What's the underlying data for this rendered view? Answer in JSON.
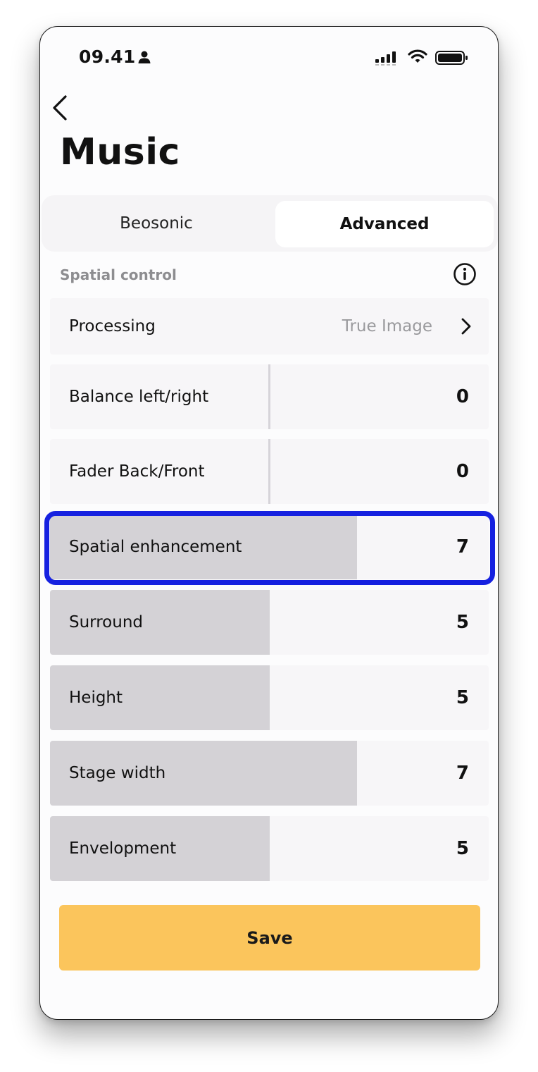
{
  "status_bar": {
    "time": "09.41"
  },
  "header": {
    "title": "Music"
  },
  "tabs": [
    {
      "label": "Beosonic",
      "active": false
    },
    {
      "label": "Advanced",
      "active": true
    }
  ],
  "section": {
    "label": "Spatial control"
  },
  "processing": {
    "label": "Processing",
    "value": "True Image"
  },
  "balance_rows": [
    {
      "label": "Balance left/right",
      "value": "0"
    },
    {
      "label": "Fader Back/Front",
      "value": "0"
    }
  ],
  "level_rows": [
    {
      "label": "Spatial enhancement",
      "value": "7",
      "level_percent": 70,
      "highlighted": true
    },
    {
      "label": "Surround",
      "value": "5",
      "level_percent": 50
    },
    {
      "label": "Height",
      "value": "5",
      "level_percent": 50
    },
    {
      "label": "Stage width",
      "value": "7",
      "level_percent": 70
    },
    {
      "label": "Envelopment",
      "value": "5",
      "level_percent": 50
    }
  ],
  "save_label": "Save",
  "colors": {
    "accent": "#fbc55c",
    "highlight": "#1621e0",
    "fill": "#d4d2d6"
  },
  "icons": [
    "person-icon",
    "signal-icon",
    "wifi-icon",
    "battery-icon",
    "chevron-left-icon",
    "info-icon",
    "chevron-right-icon"
  ]
}
